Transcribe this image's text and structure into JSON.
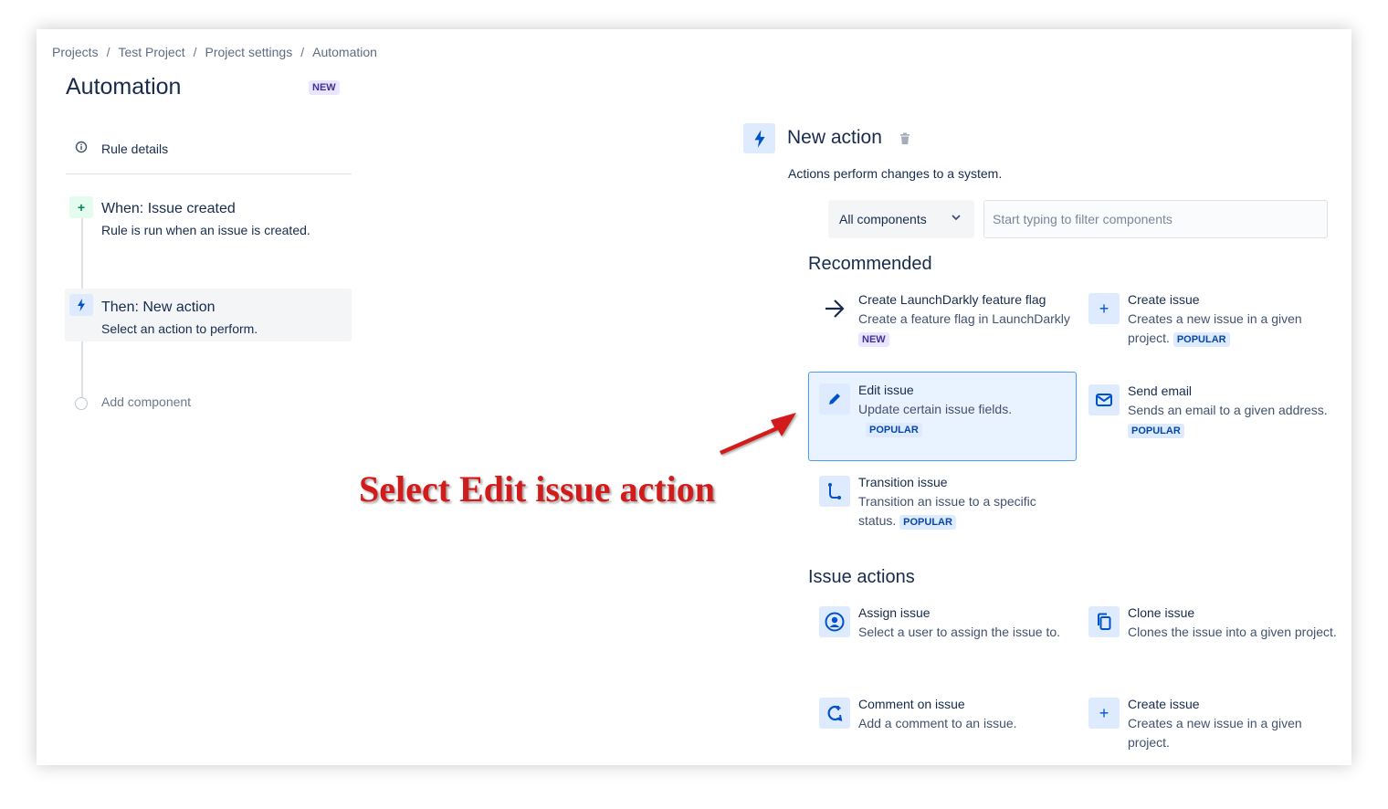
{
  "breadcrumb": {
    "items": [
      "Projects",
      "Test Project",
      "Project settings",
      "Automation"
    ],
    "separator": "/"
  },
  "page": {
    "title": "Automation",
    "badge": "NEW"
  },
  "rail": {
    "rule_details": "Rule details",
    "trigger": {
      "title": "When: Issue created",
      "subtitle": "Rule is run when an issue is created."
    },
    "action": {
      "title": "Then: New action",
      "subtitle": "Select an action to perform."
    },
    "add_component": "Add component"
  },
  "panel": {
    "title": "New action",
    "description": "Actions perform changes to a system.",
    "component_select": "All components",
    "filter_placeholder": "Start typing to filter components",
    "recommended_heading": "Recommended",
    "recommended": [
      {
        "name": "Create LaunchDarkly feature flag",
        "desc": "Create a feature flag in LaunchDarkly",
        "badge": "NEW",
        "icon": "arrow-right-icon"
      },
      {
        "name": "Create issue",
        "desc": "Creates a new issue in a given project.",
        "badge": "POPULAR",
        "icon": "plus-icon"
      },
      {
        "name": "Edit issue",
        "desc": "Update certain issue fields.",
        "badge": "POPULAR",
        "icon": "pencil-icon"
      },
      {
        "name": "Send email",
        "desc": "Sends an email to a given address.",
        "badge": "POPULAR",
        "icon": "envelope-icon"
      },
      {
        "name": "Transition issue",
        "desc": "Transition an issue to a specific status.",
        "badge": "POPULAR",
        "icon": "transition-icon"
      }
    ],
    "issue_actions_heading": "Issue actions",
    "issue_actions": [
      {
        "name": "Assign issue",
        "desc": "Select a user to assign the issue to.",
        "icon": "user-icon"
      },
      {
        "name": "Clone issue",
        "desc": "Clones the issue into a given project.",
        "icon": "clone-icon"
      },
      {
        "name": "Comment on issue",
        "desc": "Add a comment to an issue.",
        "icon": "comment-icon"
      },
      {
        "name": "Create issue",
        "desc": "Creates a new issue in a given project.",
        "icon": "plus-icon"
      }
    ]
  },
  "annotation": {
    "text": "Select Edit issue action",
    "color": "#d21b1b"
  },
  "colors": {
    "accent": "#0052cc",
    "selected_border": "#4c9aff",
    "selected_bg": "#e9f2ff"
  }
}
